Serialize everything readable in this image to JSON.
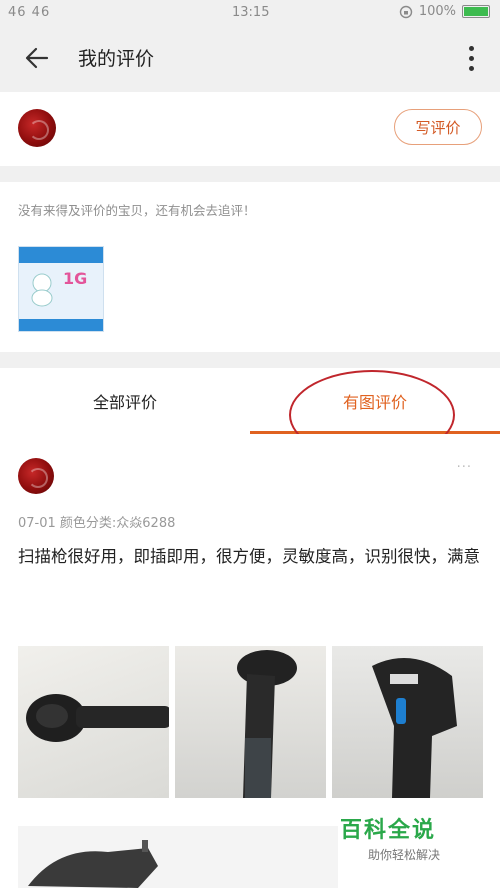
{
  "status_bar": {
    "signal_text": "46 46",
    "time": "13:15",
    "battery_text": "100%",
    "battery_level": 1.0
  },
  "app_bar": {
    "title": "我的评价",
    "back_icon": "arrow-left-icon",
    "more_icon": "more-vertical-icon"
  },
  "profile": {
    "write_review_label": "写评价"
  },
  "pending": {
    "hint": "没有来得及评价的宝贝，还有机会去追评！",
    "product_thumb_text": "1G"
  },
  "tabs": [
    {
      "label": "全部评价",
      "active": false
    },
    {
      "label": "有图评价",
      "active": true
    }
  ],
  "review": {
    "meta": "07-01 颜色分类:众焱6288",
    "text": "扫描枪很好用，即插即用，很方便，灵敏度高，识别很快，满意",
    "more": "···"
  },
  "watermark": {
    "title": "百科全说",
    "subtitle": "助你轻松解决"
  },
  "colors": {
    "accent": "#e06220",
    "annotation": "#c0262c",
    "watermark": "#2aa84a"
  }
}
